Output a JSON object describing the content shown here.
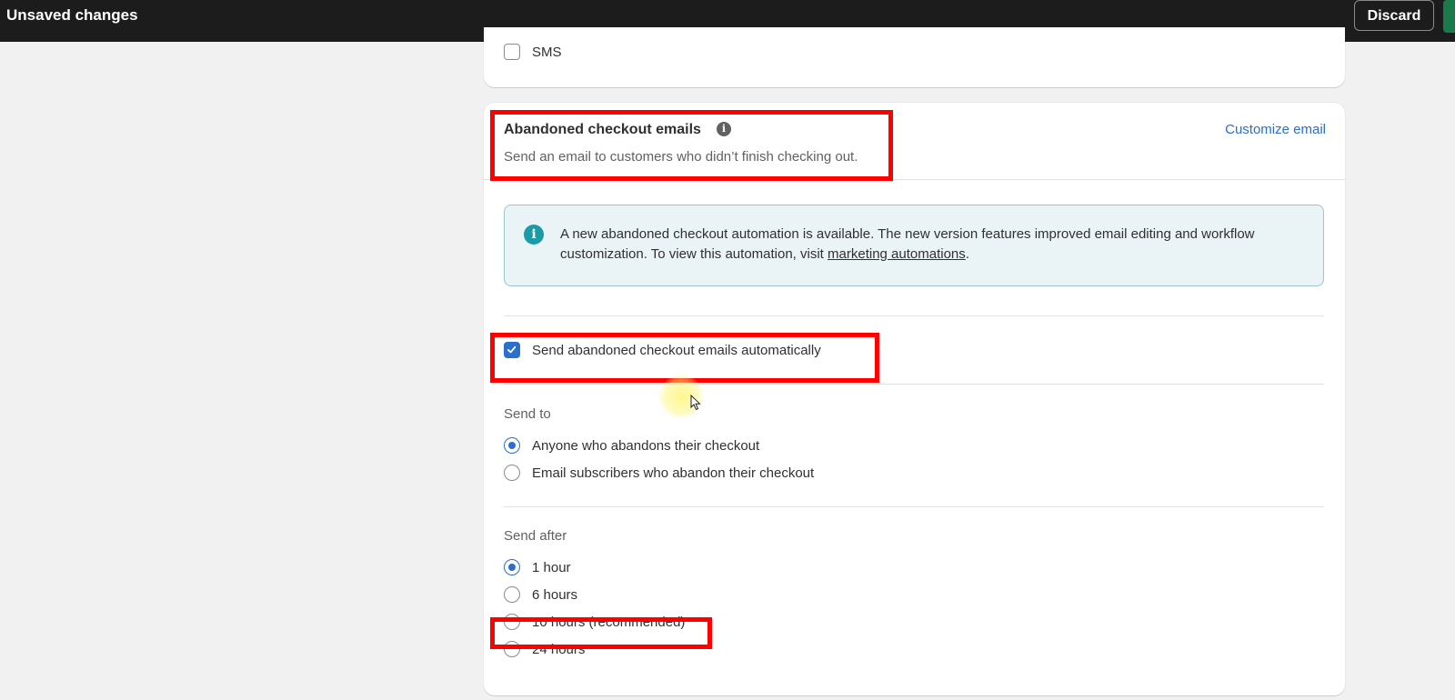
{
  "topbar": {
    "title": "Unsaved changes",
    "discard_label": "Discard"
  },
  "sms": {
    "label": "SMS",
    "checked": false
  },
  "abandoned": {
    "title": "Abandoned checkout emails",
    "subtitle": "Send an email to customers who didn’t finish checking out.",
    "customize_label": "Customize email",
    "banner": {
      "text_before": "A new abandoned checkout automation is available. The new version features improved email editing and workflow customization. To view this automation, visit ",
      "link": "marketing automations",
      "text_after": "."
    },
    "auto_send": {
      "label": "Send abandoned checkout emails automatically",
      "checked": true
    },
    "send_to": {
      "label": "Send to",
      "options": [
        {
          "label": "Anyone who abandons their checkout",
          "selected": true
        },
        {
          "label": "Email subscribers who abandon their checkout",
          "selected": false
        }
      ]
    },
    "send_after": {
      "label": "Send after",
      "options": [
        {
          "label": "1 hour",
          "selected": true
        },
        {
          "label": "6 hours",
          "selected": false
        },
        {
          "label": "10 hours (recommended)",
          "selected": false
        },
        {
          "label": "24 hours",
          "selected": false
        }
      ]
    }
  },
  "colors": {
    "accent": "#2c6ecb",
    "highlight": "#ff0000",
    "topbar": "#1c1c1c",
    "banner_bg": "#eaf4f6"
  }
}
